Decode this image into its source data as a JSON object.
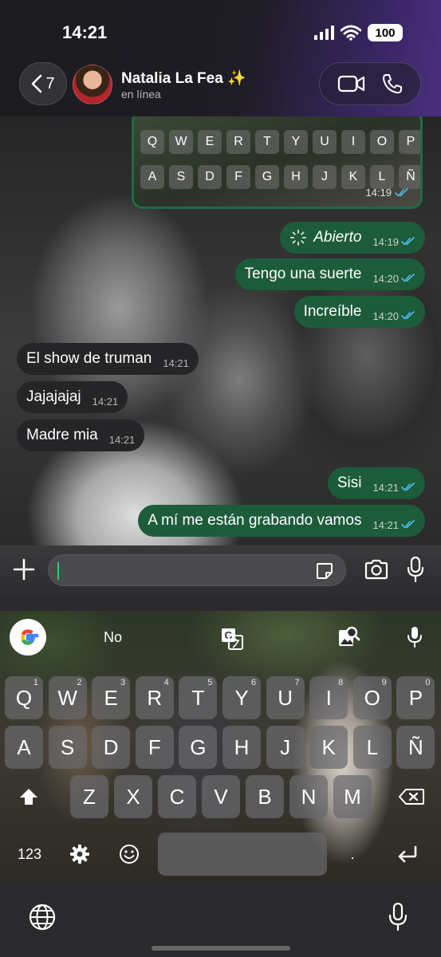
{
  "status_bar": {
    "time": "14:21",
    "battery": "100"
  },
  "header": {
    "back_count": "7",
    "contact_name": "Natalia La Fea ✨",
    "contact_status": "en línea"
  },
  "mini_keyboard": {
    "row1": [
      "Q",
      "W",
      "E",
      "R",
      "T",
      "Y",
      "U",
      "I",
      "O",
      "P"
    ],
    "row2": [
      "A",
      "S",
      "D",
      "F",
      "G",
      "H",
      "J",
      "K",
      "L",
      "Ñ"
    ],
    "time": "14:19"
  },
  "messages": [
    {
      "direction": "out",
      "text": "Abierto",
      "time": "14:19"
    },
    {
      "direction": "out",
      "text": "Tengo una suerte",
      "time": "14:20"
    },
    {
      "direction": "out",
      "text": "Increíble",
      "time": "14:20"
    },
    {
      "direction": "in",
      "text": "El show de truman",
      "time": "14:21"
    },
    {
      "direction": "in",
      "text": "Jajajajaj",
      "time": "14:21"
    },
    {
      "direction": "in",
      "text": "Madre mia",
      "time": "14:21"
    },
    {
      "direction": "out",
      "text": "Sisi",
      "time": "14:21"
    },
    {
      "direction": "out",
      "text": "A mí me están grabando vamos",
      "time": "14:21"
    }
  ],
  "composer": {
    "value": ""
  },
  "keyboard": {
    "suggestion": "No",
    "row1": [
      {
        "k": "Q",
        "h": "1"
      },
      {
        "k": "W",
        "h": "2"
      },
      {
        "k": "E",
        "h": "3"
      },
      {
        "k": "R",
        "h": "4"
      },
      {
        "k": "T",
        "h": "5"
      },
      {
        "k": "Y",
        "h": "6"
      },
      {
        "k": "U",
        "h": "7"
      },
      {
        "k": "I",
        "h": "8"
      },
      {
        "k": "O",
        "h": "9"
      },
      {
        "k": "P",
        "h": "0"
      }
    ],
    "row2": [
      "A",
      "S",
      "D",
      "F",
      "G",
      "H",
      "J",
      "K",
      "L",
      "Ñ"
    ],
    "row3": [
      "Z",
      "X",
      "C",
      "V",
      "B",
      "N",
      "M"
    ],
    "numbers_key": "123",
    "period_key": "."
  },
  "colors": {
    "outgoing_bubble": "#1d5c3b",
    "incoming_bubble": "#252527",
    "read_ticks": "#53bdeb",
    "caret": "#25d366"
  }
}
